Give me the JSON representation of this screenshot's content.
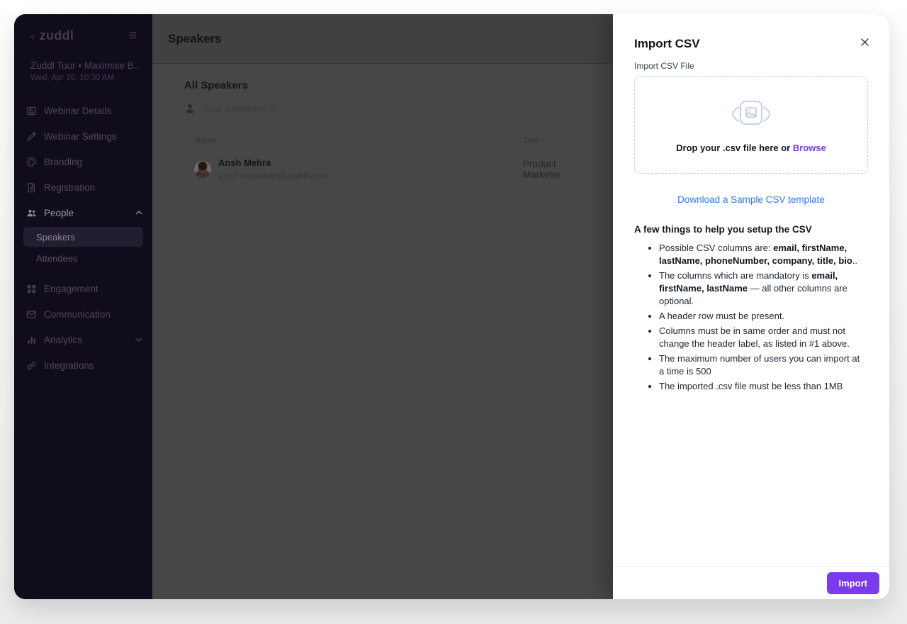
{
  "sidebar": {
    "back_icon": "‹",
    "logo": "zuddl",
    "menu_icon": "≡",
    "event_title": "Zuddl Tour • Maximise B...",
    "event_datetime": "Wed, Apr 26, 10:30 AM",
    "items": [
      {
        "label": "Webinar Details",
        "icon": "webinar-details-icon"
      },
      {
        "label": "Webinar Settings",
        "icon": "webinar-settings-icon"
      },
      {
        "label": "Branding",
        "icon": "branding-icon"
      },
      {
        "label": "Registration",
        "icon": "registration-icon",
        "chevron": "down"
      },
      {
        "label": "People",
        "icon": "people-icon",
        "chevron": "up",
        "active": true
      },
      {
        "label": "Engagement",
        "icon": "engagement-icon"
      },
      {
        "label": "Communication",
        "icon": "communication-icon"
      },
      {
        "label": "Analytics",
        "icon": "analytics-icon",
        "chevron": "down"
      },
      {
        "label": "Integrations",
        "icon": "integrations-icon"
      }
    ],
    "sub_items": [
      {
        "label": "Speakers",
        "selected": true
      },
      {
        "label": "Attendees",
        "selected": false
      }
    ]
  },
  "main": {
    "page_title": "Speakers",
    "section_title": "All Speakers",
    "total_label": "Total Speakers: 1",
    "table": {
      "columns": [
        "Name",
        "Title"
      ],
      "rows": [
        {
          "name": "Ansh Mehra",
          "email": "ansh+speaker@zuddl.com",
          "title": "Product Marketer"
        }
      ]
    }
  },
  "modal": {
    "title": "Import CSV",
    "close_icon": "×",
    "file_label": "Import CSV File",
    "drop_text": "Drop your .csv file here or",
    "browse_label": "Browse",
    "sample_link": "Download a Sample CSV template",
    "help_heading": "A few things to help you setup the CSV",
    "help_bullets": [
      [
        {
          "t": "Possible CSV columns are: "
        },
        {
          "t": "email, firstName, lastName, phoneNumber, company, title, bio",
          "b": true
        },
        {
          "t": ".."
        }
      ],
      [
        {
          "t": "The columns which are mandatory is "
        },
        {
          "t": "email, firstName, lastName",
          "b": true
        },
        {
          "t": " — all other columns are optional."
        }
      ],
      [
        {
          "t": "A header row must be present."
        }
      ],
      [
        {
          "t": "Columns must be in same order and must not change the header label, as listed in #1 above."
        }
      ],
      [
        {
          "t": "The maximum number of users you can import at a time is 500"
        }
      ],
      [
        {
          "t": "The imported .csv file must be less than 1MB"
        }
      ]
    ],
    "import_button": "Import"
  },
  "colors": {
    "accent_purple": "#7c3aed",
    "link_blue": "#2b7bf3",
    "sidebar_bg": "#110c1b",
    "dim_overlay_bg": "#474747"
  }
}
